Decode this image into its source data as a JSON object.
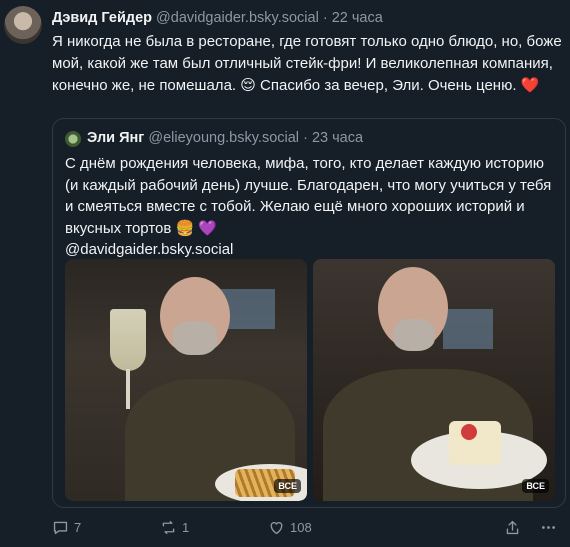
{
  "post": {
    "author_name": "Дэвид Гейдер",
    "handle": "@davidgaider.bsky.social",
    "separator": "·",
    "time": "22 часа",
    "text": "Я никогда не была в ресторане, где готовят только одно блюдо, но, боже мой, какой же там был отличный стейк-фри! И великолепная компания, конечно же, не помешала. 😌 Спасибо за вечер, Эли. Очень ценю. ❤️"
  },
  "quote": {
    "author_name": "Эли Янг",
    "handle": "@elieyoung.bsky.social",
    "separator": "·",
    "time": "23 часа",
    "text": "С днём рождения человека, мифа, того, кто делает каждую историю (и каждый рабочий день) лучше. Благодарен, что могу учиться у тебя и смеяться вместе с тобой. Желаю ещё много хороших историй и вкусных тортов 🍔 💜",
    "mention": "@davidgaider.bsky.social",
    "media": [
      {
        "alt_badge": "ВСЕ"
      },
      {
        "alt_badge": "ВСЕ"
      }
    ]
  },
  "actions": {
    "replies": "7",
    "reposts": "1",
    "likes": "108"
  },
  "icons": {
    "reply": "reply-icon",
    "repost": "repost-icon",
    "like": "heart-icon",
    "share": "share-icon",
    "more": "more-icon"
  }
}
